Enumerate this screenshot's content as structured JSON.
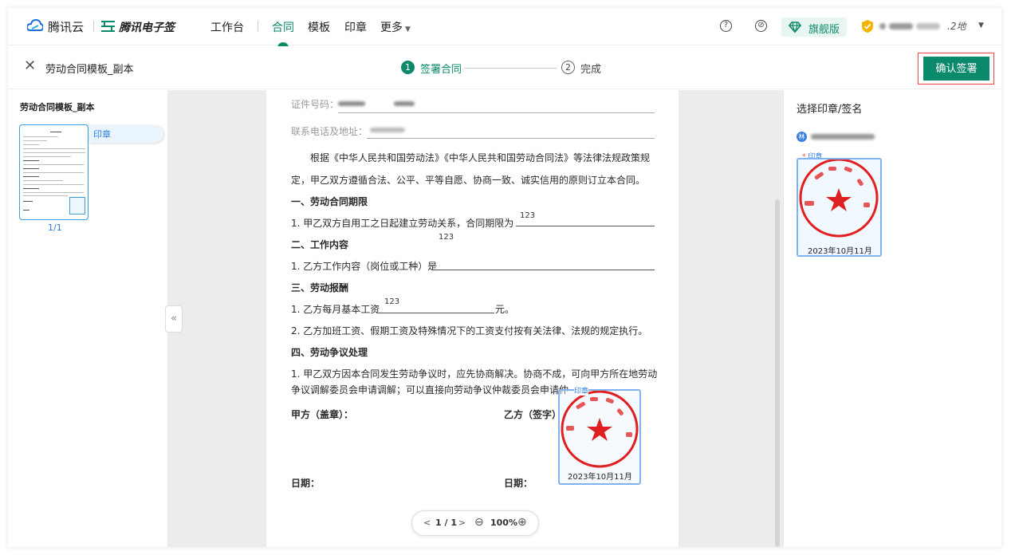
{
  "brand": {
    "cloud_name": "腾讯云",
    "esign_name": "腾讯电子签"
  },
  "nav": {
    "items": [
      "工作台",
      "合同",
      "模板",
      "印章",
      "更多"
    ],
    "active": "合同",
    "plan_badge": "旗舰版",
    "account_suffix": ".2地"
  },
  "subheader": {
    "close_label": "✕",
    "doc_title": "劳动合同模板_副本",
    "steps": [
      {
        "num": "1",
        "label": "签署合同"
      },
      {
        "num": "2",
        "label": "完成"
      }
    ],
    "confirm_label": "确认签署"
  },
  "left_panel": {
    "title": "劳动合同模板_副本",
    "tag": "印章",
    "page_indicator": "1/1"
  },
  "document": {
    "id_label": "证件号码：",
    "contact_label": "联系电话及地址：",
    "intro_line1": "根据《中华人民共和国劳动法》《中华人民共和国劳动合同法》等法律法规政策规",
    "intro_line2": "定，甲乙双方遵循合法、公平、平等自愿、协商一致、诚实信用的原则订立本合同。",
    "s1_title": "一、劳动合同期限",
    "s1_item": "1. 甲乙双方自用工之日起建立劳动关系，合同期限为",
    "s1_value": "123",
    "s2_title": "二、工作内容",
    "s2_floating": "123",
    "s2_item": "1. 乙方工作内容（岗位或工种）是",
    "s3_title": "三、劳动报酬",
    "s3_item1_pre": "1. 乙方每月基本工资",
    "s3_item1_value": "123",
    "s3_item1_post": "元。",
    "s3_item2": "2. 乙方加班工资、假期工资及特殊情况下的工资支付按有关法律、法规的规定执行。",
    "s4_title": "四、劳动争议处理",
    "s4_line1": "1. 甲乙双方因本合同发生劳动争议时，应先协商解决。协商不成，可向甲方所在地劳动",
    "s4_line2": "争议调解委员会申请调解；可以直接向劳动争议仲裁委员会申请仲",
    "party_a": "甲方（盖章）：",
    "party_b": "乙方（签字）：",
    "date_a": "日期：",
    "date_b": "日期：",
    "seal_label": "印章",
    "seal_date": "2023年10月11月"
  },
  "zoom": {
    "prev": "<",
    "page": "1 / 1",
    "next": ">",
    "zoom_out": "⊖",
    "level": "100%",
    "zoom_in": "⊕"
  },
  "right_panel": {
    "title": "选择印章/签名",
    "signer_initial": "林",
    "seal_required_mark": "*",
    "seal_tag": "印章",
    "seal_date": "2023年10月11月"
  },
  "colors": {
    "brand_green": "#0a8a6a",
    "link_blue": "#2a7ad8",
    "seal_red": "#e02020",
    "highlight_red": "#e44444"
  }
}
